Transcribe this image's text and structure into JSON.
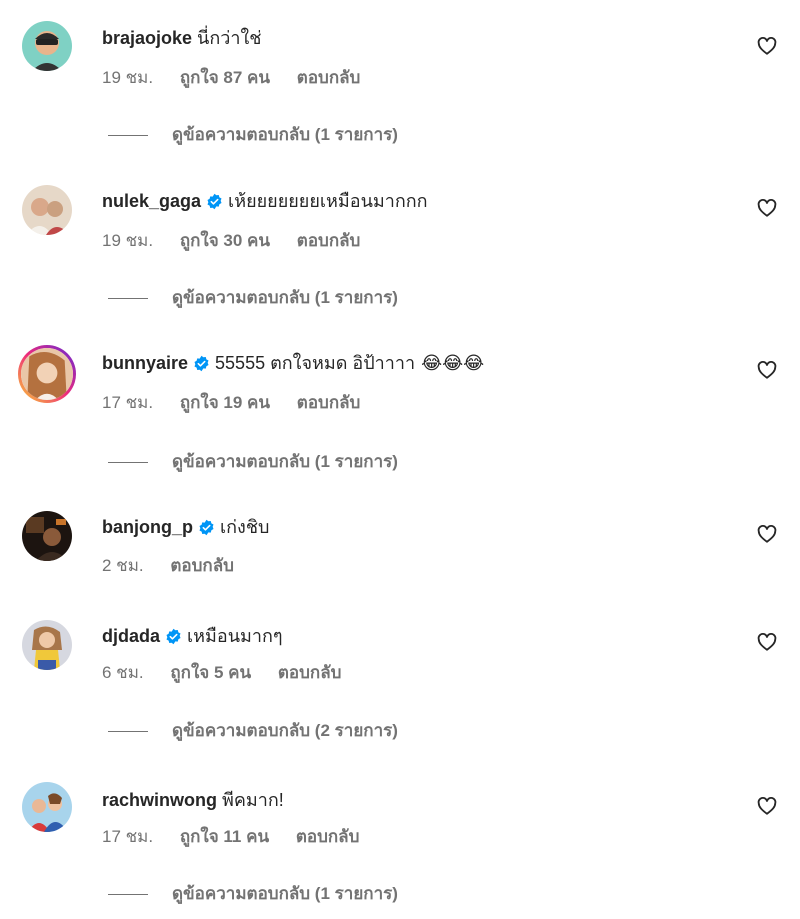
{
  "comments": [
    {
      "username": "brajaojoke",
      "verified": false,
      "text": "นี่กว่าใช่",
      "time": "19 ชม.",
      "likes": "ถูกใจ 87 คน",
      "reply": "ตอบกลับ",
      "view_replies": "ดูข้อความตอบกลับ (1 รายการ)"
    },
    {
      "username": "nulek_gaga",
      "verified": true,
      "text": "เห้ยยยยยยยเหมือนมากกก",
      "time": "19 ชม.",
      "likes": "ถูกใจ 30 คน",
      "reply": "ตอบกลับ",
      "view_replies": "ดูข้อความตอบกลับ (1 รายการ)"
    },
    {
      "username": "bunnyaire",
      "verified": true,
      "text": "55555 ตกใจหมด อิป้าาาา",
      "emoji": "😂😂😂",
      "time": "17 ชม.",
      "likes": "ถูกใจ 19 คน",
      "reply": "ตอบกลับ",
      "view_replies": "ดูข้อความตอบกลับ (1 รายการ)"
    },
    {
      "username": "banjong_p",
      "verified": true,
      "text": "เก่งชิบ",
      "time": "2 ชม.",
      "reply": "ตอบกลับ"
    },
    {
      "username": "djdada",
      "verified": true,
      "text": "เหมือนมากๆ",
      "time": "6 ชม.",
      "likes": "ถูกใจ 5 คน",
      "reply": "ตอบกลับ",
      "view_replies": "ดูข้อความตอบกลับ (2 รายการ)"
    },
    {
      "username": "rachwinwong",
      "verified": false,
      "text": "พีคมาก!",
      "time": "17 ชม.",
      "likes": "ถูกใจ 11 คน",
      "reply": "ตอบกลับ",
      "view_replies": "ดูข้อความตอบกลับ (1 รายการ)"
    }
  ],
  "icons": {
    "like": "heart-outline-icon",
    "verified": "verified-badge-icon"
  },
  "colors": {
    "verified": "#0095f6",
    "secondary_text": "#737373",
    "primary_text": "#262626"
  }
}
